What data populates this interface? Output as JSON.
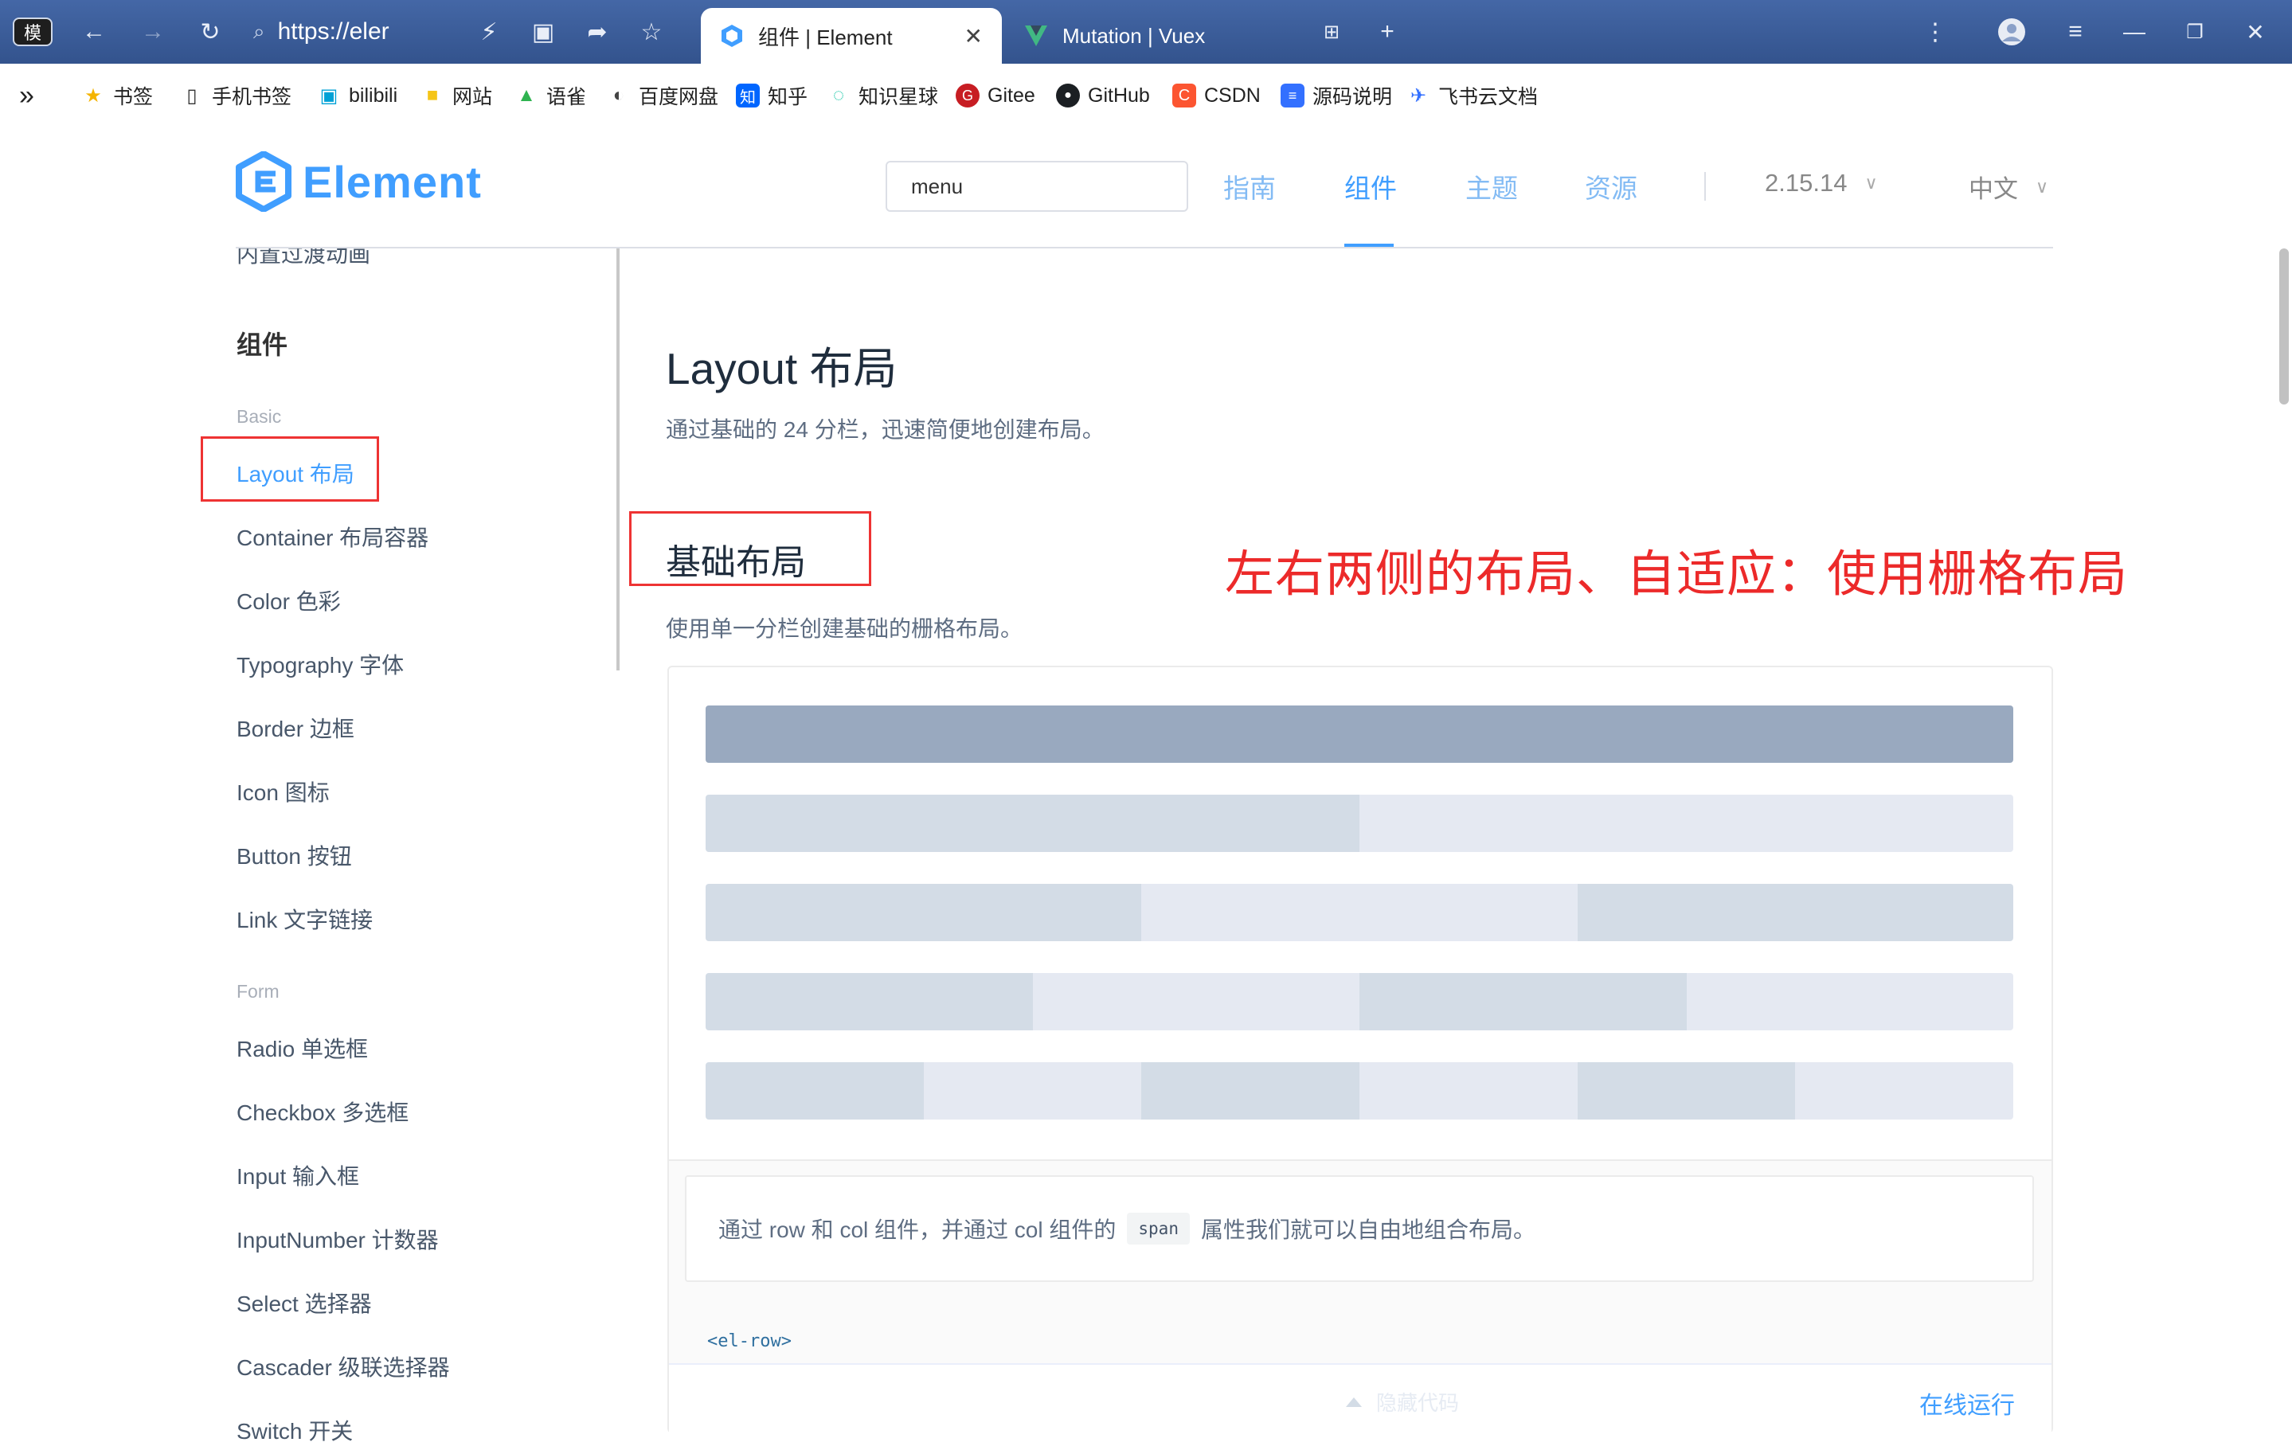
{
  "browser": {
    "address": "https://eler",
    "site_badge": "模",
    "tabs": [
      {
        "title": "组件 | Element",
        "active": true
      },
      {
        "title": "Mutation | Vuex",
        "active": false
      }
    ],
    "bookmarks": [
      {
        "label": "书签",
        "icon": "star-icon"
      },
      {
        "label": "手机书签",
        "icon": "phone-icon"
      },
      {
        "label": "bilibili",
        "icon": "bilibili-icon"
      },
      {
        "label": "网站",
        "icon": "folder-icon"
      },
      {
        "label": "语雀",
        "icon": "yuque-icon"
      },
      {
        "label": "百度网盘",
        "icon": "baidu-pan-icon"
      },
      {
        "label": "知乎",
        "icon": "zhihu-icon"
      },
      {
        "label": "知识星球",
        "icon": "planet-icon"
      },
      {
        "label": "Gitee",
        "icon": "gitee-icon"
      },
      {
        "label": "GitHub",
        "icon": "github-icon"
      },
      {
        "label": "CSDN",
        "icon": "csdn-icon"
      },
      {
        "label": "源码说明",
        "icon": "doc-icon"
      },
      {
        "label": "飞书云文档",
        "icon": "feishu-icon"
      }
    ]
  },
  "header": {
    "logo_text": "Element",
    "search_value": "menu",
    "nav": [
      "指南",
      "组件",
      "主题",
      "资源"
    ],
    "active_nav": "组件",
    "version": "2.15.14",
    "language": "中文"
  },
  "sidebar": {
    "top_cut_item": "内置过渡动画",
    "group": "组件",
    "cat_basic": "Basic",
    "basic_items": [
      "Layout 布局",
      "Container 布局容器",
      "Color 色彩",
      "Typography 字体",
      "Border 边框",
      "Icon 图标",
      "Button 按钮",
      "Link 文字链接"
    ],
    "cat_form": "Form",
    "form_items": [
      "Radio 单选框",
      "Checkbox 多选框",
      "Input 输入框",
      "InputNumber 计数器",
      "Select 选择器",
      "Cascader 级联选择器",
      "Switch 开关"
    ],
    "active_item": "Layout 布局"
  },
  "main": {
    "title": "Layout 布局",
    "desc": "通过基础的 24 分栏，迅速简便地创建布局。",
    "section_title": "基础布局",
    "annotation": "左右两侧的布局、自适应：使用栅格布局",
    "section_desc": "使用单一分栏创建基础的栅格布局。",
    "grid_rows": [
      1,
      2,
      3,
      4,
      6
    ],
    "desc_before": "通过 row 和 col 组件，并通过 col 组件的",
    "desc_code": "span",
    "desc_after": "属性我们就可以自由地组合布局。",
    "code_snippet": "<el-row>",
    "ctrl_hint": "隐藏代码",
    "run_online": "在线运行"
  },
  "colors": {
    "accent": "#409eff",
    "annotation_red": "#ec2a2a",
    "col_dark": "#99a9bf",
    "col_mid": "#d3dce6",
    "col_light": "#e5e9f2"
  }
}
